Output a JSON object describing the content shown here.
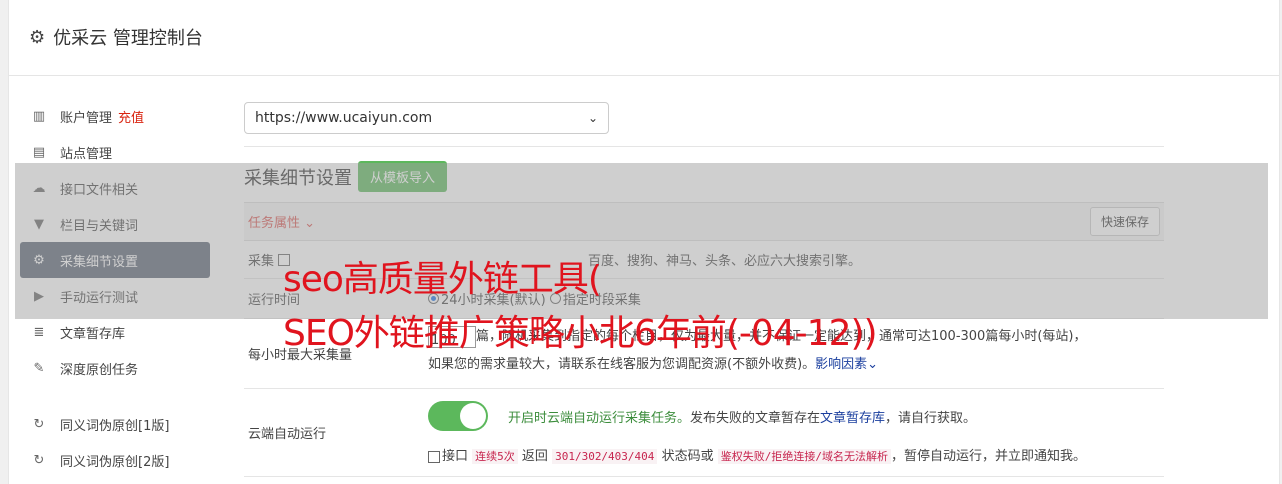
{
  "header": {
    "title": "优采云 管理控制台"
  },
  "sidebar": {
    "items": [
      {
        "icon": "bar-chart-icon",
        "glyph": "▥",
        "label": "账户管理",
        "badge": "充值"
      },
      {
        "icon": "server-icon",
        "glyph": "▤",
        "label": "站点管理"
      },
      {
        "icon": "cloud-icon",
        "glyph": "☁",
        "label": "接口文件相关"
      },
      {
        "icon": "filter-icon",
        "glyph": "▼",
        "label": "栏目与关键词"
      },
      {
        "icon": "cogs-icon",
        "glyph": "⚙",
        "label": "采集细节设置",
        "active": true
      },
      {
        "icon": "play-icon",
        "glyph": "▶",
        "label": "手动运行测试"
      },
      {
        "icon": "database-icon",
        "glyph": "≣",
        "label": "文章暂存库"
      },
      {
        "icon": "edit-icon",
        "glyph": "✎",
        "label": "深度原创任务"
      },
      {
        "icon": "refresh-icon",
        "glyph": "↻",
        "label": "同义词伪原创[1版]"
      },
      {
        "icon": "refresh-icon",
        "glyph": "↻",
        "label": "同义词伪原创[2版]"
      }
    ]
  },
  "main": {
    "site_select": "https://www.ucaiyun.com",
    "section_title": "采集细节设置",
    "import_button": "从模板导入",
    "table_header": "任务属性",
    "quick_save": "快速保存",
    "rows": {
      "collect_label": "采集",
      "collect_text": "百度、搜狗、神马、头条、必应六大搜索引擎。",
      "runtime_label": "运行时间",
      "runtime_opt1": "24小时采集(默认)",
      "runtime_opt2": "指定时段采集",
      "max_label": "每小时最大采集量",
      "max_value": "100",
      "max_text": "篇，随机采集到指定的每个栏目，仅为最大量，并不保证一定能达到，通常可达100-300篇每小时(每站)，",
      "max_text2": "如果您的需求量较大，请联系在线客服为您调配资源(不额外收费)。",
      "max_link": "影响因素",
      "cloud_label": "云端自动运行",
      "cloud_green": "开启时云端自动运行采集任务。",
      "cloud_text": "发布失败的文章暂存在",
      "cloud_link": "文章暂存库",
      "cloud_text2": "，请自行获取。",
      "api_prefix": "接口",
      "api_code1": "连续5次",
      "api_mid": "返回",
      "api_code2": "301/302/403/404",
      "api_mid2": "状态码或",
      "api_code3": "鉴权失败/拒绝连接/域名无法解析",
      "api_suffix": "，暂停自动运行，并立即通知我。"
    }
  },
  "overlay": {
    "line1": "seo高质量外链工具(",
    "line2": "SEO外链推广策略小北6年前(-04-12))"
  }
}
